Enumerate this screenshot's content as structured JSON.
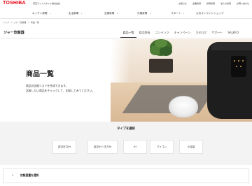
{
  "header": {
    "logo": "TOSHIBA",
    "company": "東芝ライフスタイル株式会社",
    "util_links": [
      "お知らせ",
      "企業情報",
      "採用情報",
      "法人の皆様",
      "お問い合わせ"
    ]
  },
  "main_nav": {
    "items": [
      "キッチン家電",
      "生活家電",
      "空調家電",
      "冷蔵家電",
      "サポート",
      "公式オンラインショップ"
    ]
  },
  "breadcrumb": [
    "トップ",
    "ジャー炊飯器",
    "商品一覧"
  ],
  "subheader": {
    "section_title": "ジャー炊飯器",
    "tabs": [
      {
        "label": "商品一覧",
        "active": true
      },
      {
        "label": "商品特長",
        "active": false
      },
      {
        "label": "コンテンツ",
        "active": false
      },
      {
        "label": "キャンペーン",
        "active": false
      },
      {
        "label": "カタログ",
        "active": false
      },
      {
        "label": "サポート",
        "active": false
      },
      {
        "label": "SALEFO",
        "active": false
      }
    ]
  },
  "hero": {
    "title": "商品一覧",
    "desc_line1": "商品の比較リストを作成できます。",
    "desc_line2": "比較したい商品をチェックして、比較してみてください。"
  },
  "type_filter": {
    "heading": "タイプを選択",
    "buttons": [
      "真空圧力IH",
      "真空IH・圧力IH",
      "IH",
      "マイコン",
      "小容量"
    ]
  },
  "condition_bar": {
    "label": "炊飯容量を選択"
  },
  "colors": {
    "brand_red": "#e60012",
    "band_bg": "#f3f3f3"
  }
}
